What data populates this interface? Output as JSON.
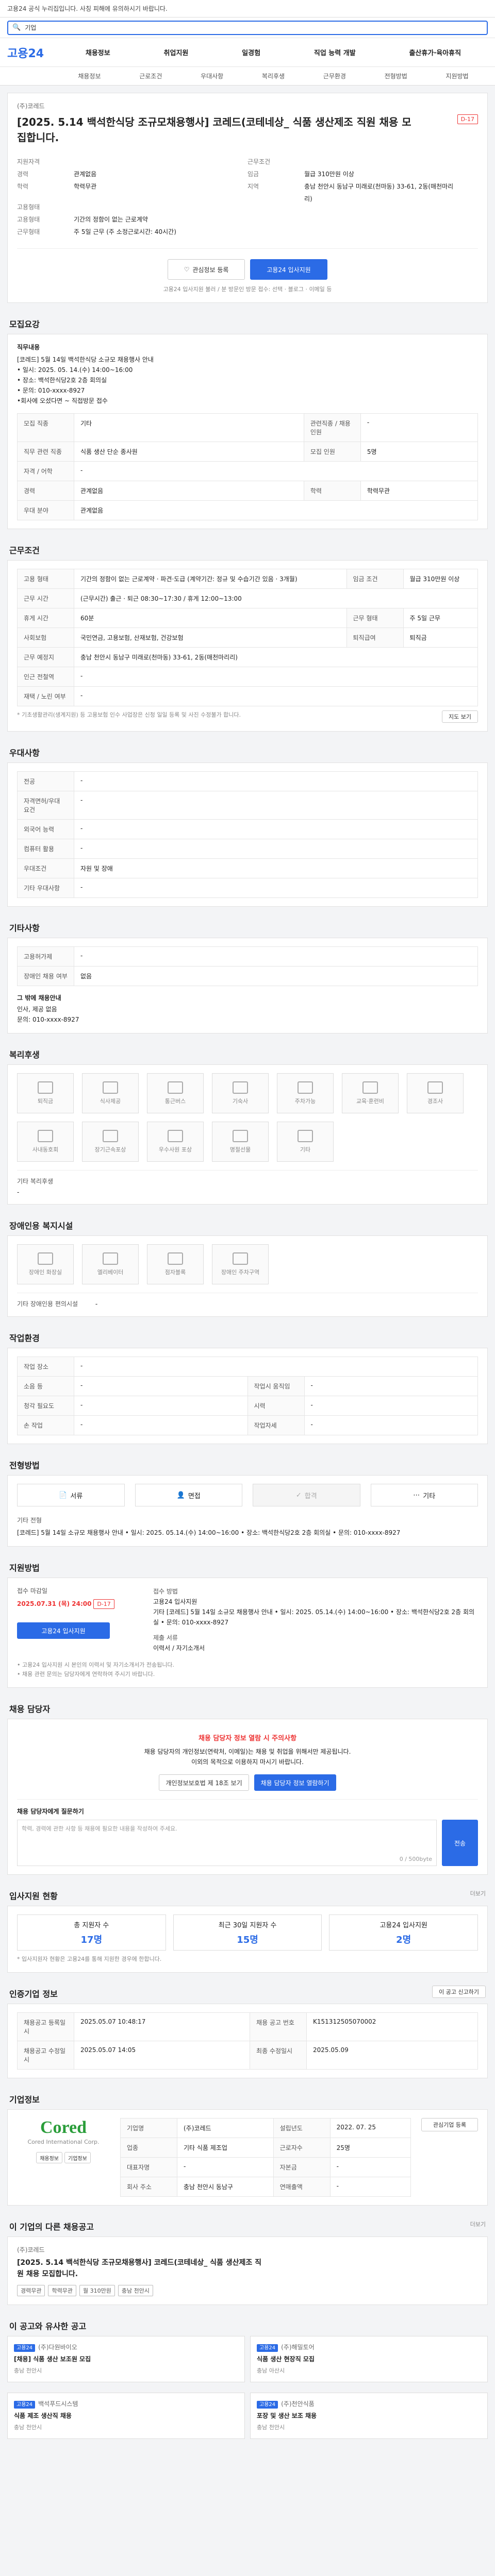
{
  "notice": "고용24 공식 누리집입니다. 사칭 피해에 유의하시기 바랍니다.",
  "search": {
    "placeholder": "기업",
    "label": "통합검색"
  },
  "header": {
    "logo": "고용24",
    "nav": [
      "채용정보",
      "취업지원",
      "일경험",
      "직업 능력 개발",
      "출산휴가·육아휴직"
    ],
    "subnav": [
      "채용정보",
      "근로조건",
      "우대사항",
      "복리후생",
      "근무환경",
      "전형방법",
      "지원방법"
    ]
  },
  "job": {
    "company": "(주)코레드",
    "title": "[2025. 5.14 백석한식당 조규모채용행사] 코레드(코테네상_ 식품 생산제조 직원 채용 모집합니다.",
    "dday": "D-17",
    "left": [
      {
        "k": "지원자격",
        "v": ""
      },
      {
        "k": "경력",
        "v": "관계없음"
      },
      {
        "k": "학력",
        "v": "학력무관"
      },
      {
        "k": "고용형태",
        "v": ""
      },
      {
        "k": "고용형태",
        "v": "기간의 정함이 없는 근로계약"
      },
      {
        "k": "근무형태",
        "v": "주 5일 근무 (주 소정근로시간: 40시간)"
      }
    ],
    "right": [
      {
        "k": "근무조건",
        "v": ""
      },
      {
        "k": "임금",
        "v": "월급 310만원 이상"
      },
      {
        "k": "지역",
        "v": "충남 천안시 동남구 미래로(천마동) 33-61, 2동(매천마리리)"
      }
    ],
    "buttons": {
      "save": "관심정보 등록",
      "apply": "고용24 입사지원"
    },
    "footnote": "고용24 입사지원 불러 / 분 방문인 방문 접수: 선택 · 블로그 · 이메일 등"
  },
  "recruit": {
    "title": "모집요강",
    "duty_label": "직무내용",
    "duty_text": "[코레드] 5월 14일 백석한식당 소규모 채용행사 안내\n• 일시: 2025. 05. 14.(수) 14:00~16:00\n• 장소: 백석한식당2호 2층 회의실\n• 문의: 010-xxxx-8927\n•회사에 오셨다면 ~ 직접방문 접수",
    "rows": [
      [
        "모집 직종",
        "기타",
        "관련직종 / 채용 인원",
        "-"
      ],
      [
        "직무 관련 직종",
        "식품 생산 단순 종사원",
        "모집 인원",
        "5명"
      ],
      [
        "자격 / 어학",
        "-",
        "",
        ""
      ],
      [
        "경력",
        "관계없음",
        "학력",
        "학력무관"
      ],
      [
        "우대 분야",
        "관계없음",
        "",
        ""
      ]
    ]
  },
  "conditions": {
    "title": "근무조건",
    "rows": [
      [
        "고용 형태",
        "기간의 정함이 없는 근로계약 · 파견·도급 (계약기간: 정규 및 수습기간 있음 · 3개월)",
        "임금 조건",
        "월급 310만원 이상"
      ],
      [
        "근무 시간",
        "(근무시간) 출근 · 퇴근 08:30~17:30 / 휴게 12:00~13:00",
        "",
        ""
      ],
      [
        "휴게 시간",
        "60분",
        "근무 형태",
        "주 5일 근무"
      ],
      [
        "사회보험",
        "국민연금, 고용보험, 산재보험, 건강보험",
        "퇴직급여",
        "퇴직금"
      ],
      [
        "근무 예정지",
        "충남 천안시 동남구 미래로(천마동) 33-61, 2동(매천마리리)",
        "",
        ""
      ],
      [
        "인근 전철역",
        "-",
        "",
        ""
      ],
      [
        "재택 / 노린 여부",
        "-",
        "",
        ""
      ]
    ],
    "note": "* 기초생활관리(생계지원) 등 고용보험 인수 사업장은 신청 일일 등록 및 사진 수정불가 합니다.",
    "map_button": "지도 보기"
  },
  "preference": {
    "title": "우대사항",
    "rows": [
      [
        "전공",
        "-"
      ],
      [
        "자격면허/우대 요건",
        "-"
      ],
      [
        "외국어 능력",
        "-"
      ],
      [
        "컴퓨터 활용",
        "-"
      ],
      [
        "우대조건",
        "자원 및 장애"
      ],
      [
        "기타 우대사항",
        "-"
      ]
    ]
  },
  "other_cond": {
    "title": "기타사항",
    "rows": [
      [
        "고용허가제",
        "-"
      ],
      [
        "장애인 채용 여부",
        "없음"
      ]
    ],
    "contact_title": "그 밖에 채용안내",
    "contact": "인사, 제공 없음\n문의: 010-xxxx-8927"
  },
  "welfare": {
    "title": "복리후생",
    "icons": [
      "퇴직금",
      "식사제공",
      "통근버스",
      "기숙사",
      "주차가능",
      "교육·훈련비",
      "경조사",
      "사내동호회",
      "장기근속포상",
      "우수사원 포상",
      "명절선물",
      "기타"
    ],
    "etc_label": "기타 복리후생",
    "etc_value": "-"
  },
  "disability": {
    "title": "장애인용 복지시설",
    "icons": [
      "장애인 화장실",
      "엘리베이터",
      "점자블록",
      "장애인 주차구역"
    ],
    "etc_label": "기타 장애인용 편의시설",
    "etc_value": "-"
  },
  "environment": {
    "title": "작업환경",
    "rows": [
      [
        "작업 장소",
        "-",
        "",
        ""
      ],
      [
        "소음 등",
        "-",
        "작업시 움직임",
        "-"
      ],
      [
        "청각 필요도",
        "-",
        "시력",
        "-"
      ],
      [
        "손 작업",
        "-",
        "작업자세",
        "-"
      ]
    ]
  },
  "process": {
    "title": "전형방법",
    "steps": [
      "서류",
      "면접",
      "합격",
      "기타"
    ],
    "detail_label": "기타 전형",
    "detail": "[코레드] 5월 14일 소규모 채용행사 안내 • 일시: 2025. 05.14.(수) 14:00~16:00 • 장소: 백석한식당2호 2층 회의실 • 문의: 010-xxxx-8927"
  },
  "apply": {
    "title": "지원방법",
    "deadline_label": "접수 마감일",
    "deadline": "2025.07.31 (목) 24:00",
    "dday": "D-17",
    "method_label": "접수 방법",
    "method": "고용24 입사지원\n기타 [코레드] 5월 14일 소규모 채용행사 안내 • 일시: 2025. 05.14.(수) 14:00~16:00 • 장소: 백석한식당2호 2층 회의실 • 문의: 010-xxxx-8927",
    "docs_label": "제출 서류",
    "docs": "이력서 / 자기소개서",
    "button": "고용24 입사지원",
    "notes": "• 고용24 입사지원 시 본인의 이력서 및 자기소개서가 전송됩니다.\n• 채용 관련 문의는 담당자에게 연락하여 주시기 바랍니다."
  },
  "manager": {
    "title": "채용 담당자",
    "warning_title": "채용 담당자 정보 열람 시 주의사항",
    "warning_text": "채용 담당자의 개인정보(연락처, 이메일)는 채용 및 취업을 위해서만 제공됩니다.\n이외의 목적으로 이용하지 마시기 바랍니다.",
    "btn_left": "개인정보보호법 제 18조 보기",
    "btn_right": "채용 담당자 정보 열람하기",
    "question_label": "채용 담당자에게 질문하기",
    "placeholder": "학력, 경력에 관한 사항 등 채용에 필요한 내용을 작성하여 주세요.",
    "counter": "0 / 500byte",
    "send": "전송"
  },
  "applicants": {
    "title": "입사지원 현황",
    "link": "더보기",
    "stats": [
      {
        "label": "총 지원자 수",
        "value": "17명"
      },
      {
        "label": "최근 30일 지원자 수",
        "value": "15명"
      },
      {
        "label": "고용24 입사지원",
        "value": "2명"
      }
    ],
    "note": "* 입사지원자 현황은 고용24를 통해 지원한 경우에 한합니다."
  },
  "info": {
    "title": "인증기업 정보",
    "rows": [
      [
        "채용공고 등록일시",
        "2025.05.07 10:48:17",
        "채용 공고 번호",
        "K151312505070002"
      ],
      [
        "채용공고 수정일시",
        "2025.05.07 14:05",
        "최종 수정일시",
        "2025.05.09"
      ]
    ],
    "button": "이 공고 신고하기"
  },
  "company": {
    "title": "기업정보",
    "logo": "Cored",
    "logo_sub": "Cored International Corp.",
    "rows": [
      [
        "기업명",
        "(주)코레드",
        "설립년도",
        "2022. 07. 25"
      ],
      [
        "업종",
        "기타 식품 제조업",
        "근로자수",
        "25명"
      ],
      [
        "대표자명",
        "-",
        "자본금",
        "-"
      ],
      [
        "회사 주소",
        "충남 천안시 동남구",
        "연매출액",
        "-"
      ]
    ],
    "buttons": [
      "채용정보",
      "기업정보",
      "관심기업 등록"
    ]
  },
  "similar": {
    "title": "이 기업의 다른 채용공고",
    "link": "더보기",
    "card": {
      "company": "(주)코레드",
      "title": "[2025. 5.14 백석한식당 조규모채용행사] 코레드(코테네상_ 식품 생산제조 직원 채용 모집합니다.",
      "tags": [
        "경력무관",
        "학력무관",
        "월 310만원",
        "충남 천안시"
      ]
    }
  },
  "recommend": {
    "title": "이 공고와 유사한 공고",
    "items": [
      {
        "badge": "고용24",
        "company": "(주)다원바이오",
        "title": "[채용] 식품 생산 보조원 모집",
        "region": "충남 천안시"
      },
      {
        "badge": "고용24",
        "company": "(주)해밀토어",
        "title": "식품 생산 현장직 모집",
        "region": "충남 아산시"
      },
      {
        "badge": "고용24",
        "company": "백석푸드시스템",
        "title": "식품 제조 생산직 채용",
        "region": "충남 천안시"
      },
      {
        "badge": "고용24",
        "company": "(주)천안식품",
        "title": "포장 및 생산 보조 채용",
        "region": "충남 천안시"
      }
    ]
  }
}
